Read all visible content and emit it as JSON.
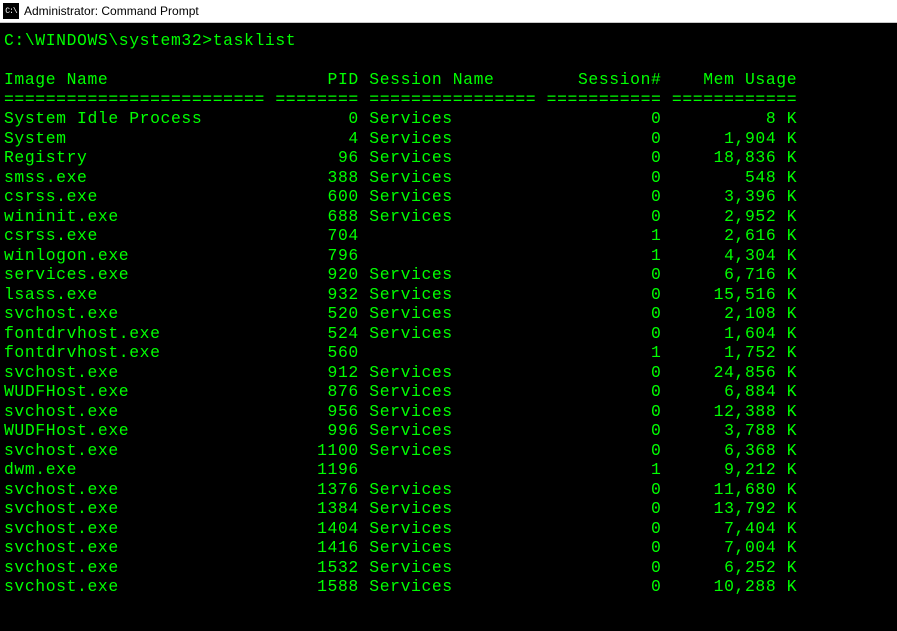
{
  "window": {
    "icon_label": "C:\\",
    "title": "Administrator: Command Prompt"
  },
  "terminal": {
    "prompt": "C:\\WINDOWS\\system32>",
    "command": "tasklist",
    "columns": {
      "image": "Image Name",
      "pid": "PID",
      "session_name": "Session Name",
      "session_num": "Session#",
      "mem": "Mem Usage"
    },
    "widths": {
      "image": 25,
      "pid": 8,
      "session_name": 16,
      "session_num": 11,
      "mem": 12
    },
    "rows": [
      {
        "image": "System Idle Process",
        "pid": "0",
        "session_name": "Services",
        "session_num": "0",
        "mem": "8 K"
      },
      {
        "image": "System",
        "pid": "4",
        "session_name": "Services",
        "session_num": "0",
        "mem": "1,904 K"
      },
      {
        "image": "Registry",
        "pid": "96",
        "session_name": "Services",
        "session_num": "0",
        "mem": "18,836 K"
      },
      {
        "image": "smss.exe",
        "pid": "388",
        "session_name": "Services",
        "session_num": "0",
        "mem": "548 K"
      },
      {
        "image": "csrss.exe",
        "pid": "600",
        "session_name": "Services",
        "session_num": "0",
        "mem": "3,396 K"
      },
      {
        "image": "wininit.exe",
        "pid": "688",
        "session_name": "Services",
        "session_num": "0",
        "mem": "2,952 K"
      },
      {
        "image": "csrss.exe",
        "pid": "704",
        "session_name": "",
        "session_num": "1",
        "mem": "2,616 K"
      },
      {
        "image": "winlogon.exe",
        "pid": "796",
        "session_name": "",
        "session_num": "1",
        "mem": "4,304 K"
      },
      {
        "image": "services.exe",
        "pid": "920",
        "session_name": "Services",
        "session_num": "0",
        "mem": "6,716 K"
      },
      {
        "image": "lsass.exe",
        "pid": "932",
        "session_name": "Services",
        "session_num": "0",
        "mem": "15,516 K"
      },
      {
        "image": "svchost.exe",
        "pid": "520",
        "session_name": "Services",
        "session_num": "0",
        "mem": "2,108 K"
      },
      {
        "image": "fontdrvhost.exe",
        "pid": "524",
        "session_name": "Services",
        "session_num": "0",
        "mem": "1,604 K"
      },
      {
        "image": "fontdrvhost.exe",
        "pid": "560",
        "session_name": "",
        "session_num": "1",
        "mem": "1,752 K"
      },
      {
        "image": "svchost.exe",
        "pid": "912",
        "session_name": "Services",
        "session_num": "0",
        "mem": "24,856 K"
      },
      {
        "image": "WUDFHost.exe",
        "pid": "876",
        "session_name": "Services",
        "session_num": "0",
        "mem": "6,884 K"
      },
      {
        "image": "svchost.exe",
        "pid": "956",
        "session_name": "Services",
        "session_num": "0",
        "mem": "12,388 K"
      },
      {
        "image": "WUDFHost.exe",
        "pid": "996",
        "session_name": "Services",
        "session_num": "0",
        "mem": "3,788 K"
      },
      {
        "image": "svchost.exe",
        "pid": "1100",
        "session_name": "Services",
        "session_num": "0",
        "mem": "6,368 K"
      },
      {
        "image": "dwm.exe",
        "pid": "1196",
        "session_name": "",
        "session_num": "1",
        "mem": "9,212 K"
      },
      {
        "image": "svchost.exe",
        "pid": "1376",
        "session_name": "Services",
        "session_num": "0",
        "mem": "11,680 K"
      },
      {
        "image": "svchost.exe",
        "pid": "1384",
        "session_name": "Services",
        "session_num": "0",
        "mem": "13,792 K"
      },
      {
        "image": "svchost.exe",
        "pid": "1404",
        "session_name": "Services",
        "session_num": "0",
        "mem": "7,404 K"
      },
      {
        "image": "svchost.exe",
        "pid": "1416",
        "session_name": "Services",
        "session_num": "0",
        "mem": "7,004 K"
      },
      {
        "image": "svchost.exe",
        "pid": "1532",
        "session_name": "Services",
        "session_num": "0",
        "mem": "6,252 K"
      },
      {
        "image": "svchost.exe",
        "pid": "1588",
        "session_name": "Services",
        "session_num": "0",
        "mem": "10,288 K"
      }
    ]
  }
}
